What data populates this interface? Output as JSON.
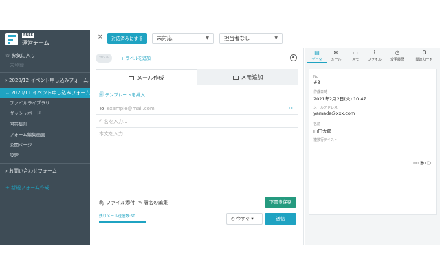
{
  "sidebar": {
    "free_badge": "FREE",
    "team_name": "運営チーム",
    "favorites": "お気に入り",
    "unset": "未登録",
    "items": [
      {
        "label": "2020/12 イベント申し込みフォーム..."
      },
      {
        "label": "2020/11 イベント申し込みフォーム..."
      }
    ],
    "sub_items": [
      "ファイルライブラリ",
      "ダッシュボード",
      "回答集計",
      "フォーム編集画面",
      "公開ページ",
      "設定"
    ],
    "contact_form": "お問い合わせフォーム",
    "new_form": "+ 新規フォーム作成"
  },
  "topbar": {
    "close": "×",
    "done_button": "対応済みにする",
    "status_select": "未対応",
    "assignee_select": "担当者なし"
  },
  "compose": {
    "label_pill": "ラベル",
    "add_label": "+ ラベルを追加",
    "tabs": [
      {
        "label": "メール作成"
      },
      {
        "label": "メモ追加"
      }
    ],
    "template_link": "テンプレートを挿入",
    "to_label": "To",
    "to_placeholder": "example@mail.com",
    "cc": "CC",
    "subject_placeholder": "件名を入力...",
    "body_placeholder": "本文を入力...",
    "attach": "ファイル添付",
    "signature": "署名の編集",
    "draft_button": "下書き保存",
    "remaining": "残りメール送信数:50",
    "remaining_fraction": 1.0,
    "send_timing": "今すぐ",
    "send_button": "送信"
  },
  "right": {
    "tabs": [
      {
        "label": "データ",
        "icon": "data-icon"
      },
      {
        "label": "メール",
        "icon": "mail-icon"
      },
      {
        "label": "メモ",
        "icon": "memo-icon"
      },
      {
        "label": "ファイル",
        "icon": "clip-icon"
      },
      {
        "label": "変更履歴",
        "icon": "clock-icon"
      },
      {
        "label": "関連カード",
        "icon": "count-icon",
        "count": "0"
      }
    ],
    "fields": [
      {
        "key": "No",
        "value": "#3"
      },
      {
        "key": "作成日時",
        "value": "2021年2月2日(火) 10:47"
      },
      {
        "key": "メールアドレス",
        "value": "yamada@xxx.com"
      },
      {
        "key": "名前",
        "value": "山田太郎"
      },
      {
        "key": "複数行テキスト",
        "value": "-"
      }
    ],
    "footer_counts": "✉0 🗎0 🗋0"
  },
  "colors": {
    "accent": "#1fa3c2",
    "sidebar": "#3e4c56",
    "draft_green": "#259a7f"
  }
}
